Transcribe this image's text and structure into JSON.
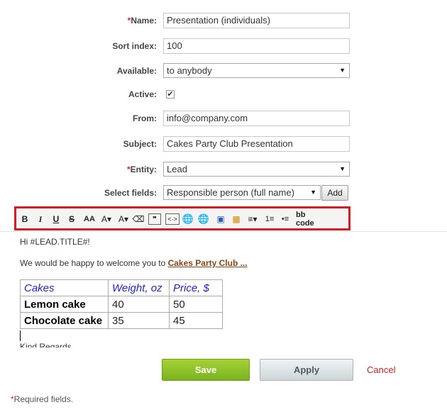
{
  "form": {
    "name": {
      "label": "Name:",
      "required_mark": "*",
      "value": "Presentation (individuals)"
    },
    "sort_index": {
      "label": "Sort index:",
      "value": "100"
    },
    "available": {
      "label": "Available:",
      "value": "to anybody"
    },
    "active": {
      "label": "Active:",
      "checked": true,
      "check_glyph": "✔"
    },
    "from": {
      "label": "From:",
      "value": "info@company.com"
    },
    "subject": {
      "label": "Subject:",
      "value": "Cakes Party Club Presentation"
    },
    "entity": {
      "label": "Entity:",
      "required_mark": "*",
      "value": "Lead"
    },
    "select_fields": {
      "label": "Select fields:",
      "value": "Responsible person (full name)",
      "add_label": "Add"
    }
  },
  "toolbar": {
    "border_color": "#d21f26",
    "buttons": [
      {
        "name": "bold",
        "glyph": "B"
      },
      {
        "name": "italic",
        "glyph": "I"
      },
      {
        "name": "underline",
        "glyph": "U"
      },
      {
        "name": "strikethrough",
        "glyph": "S"
      },
      {
        "name": "font-family",
        "glyph": "AA"
      },
      {
        "name": "font-size",
        "glyph": "A▾"
      },
      {
        "name": "font-color",
        "glyph": "A▾"
      },
      {
        "name": "remove-format",
        "glyph": "⌫"
      },
      {
        "name": "quote",
        "glyph": "❞"
      },
      {
        "name": "code",
        "glyph": "<·>"
      },
      {
        "name": "insert-link",
        "glyph": "🌐"
      },
      {
        "name": "remove-link",
        "glyph": "🌐"
      },
      {
        "name": "insert-image",
        "glyph": "▣"
      },
      {
        "name": "insert-table",
        "glyph": "▦"
      },
      {
        "name": "align",
        "glyph": "≡▾"
      },
      {
        "name": "ordered-list",
        "glyph": "1≡"
      },
      {
        "name": "unordered-list",
        "glyph": "•≡"
      },
      {
        "name": "bb-code",
        "glyph": "bb code"
      }
    ]
  },
  "editor": {
    "greeting": "Hi #LEAD.TITLE#!",
    "welcome_text": "We would be happy to welcome you to ",
    "welcome_link": "Cakes Party Club ...",
    "table": {
      "headers": [
        "Cakes",
        "Weight, oz",
        "Price, $"
      ],
      "rows": [
        [
          "Lemon cake",
          "40",
          "50"
        ],
        [
          "Chocolate cake",
          "35",
          "45"
        ]
      ]
    },
    "closing": "Kind Regards"
  },
  "actions": {
    "save": "Save",
    "apply": "Apply",
    "cancel": "Cancel"
  },
  "footer": {
    "required_mark": "*",
    "required_note": "Required fields."
  },
  "colors": {
    "accent_red": "#d21f26",
    "save_green": "#8bc34a",
    "link_brown": "#8b4513",
    "header_blue": "#2222cc"
  }
}
